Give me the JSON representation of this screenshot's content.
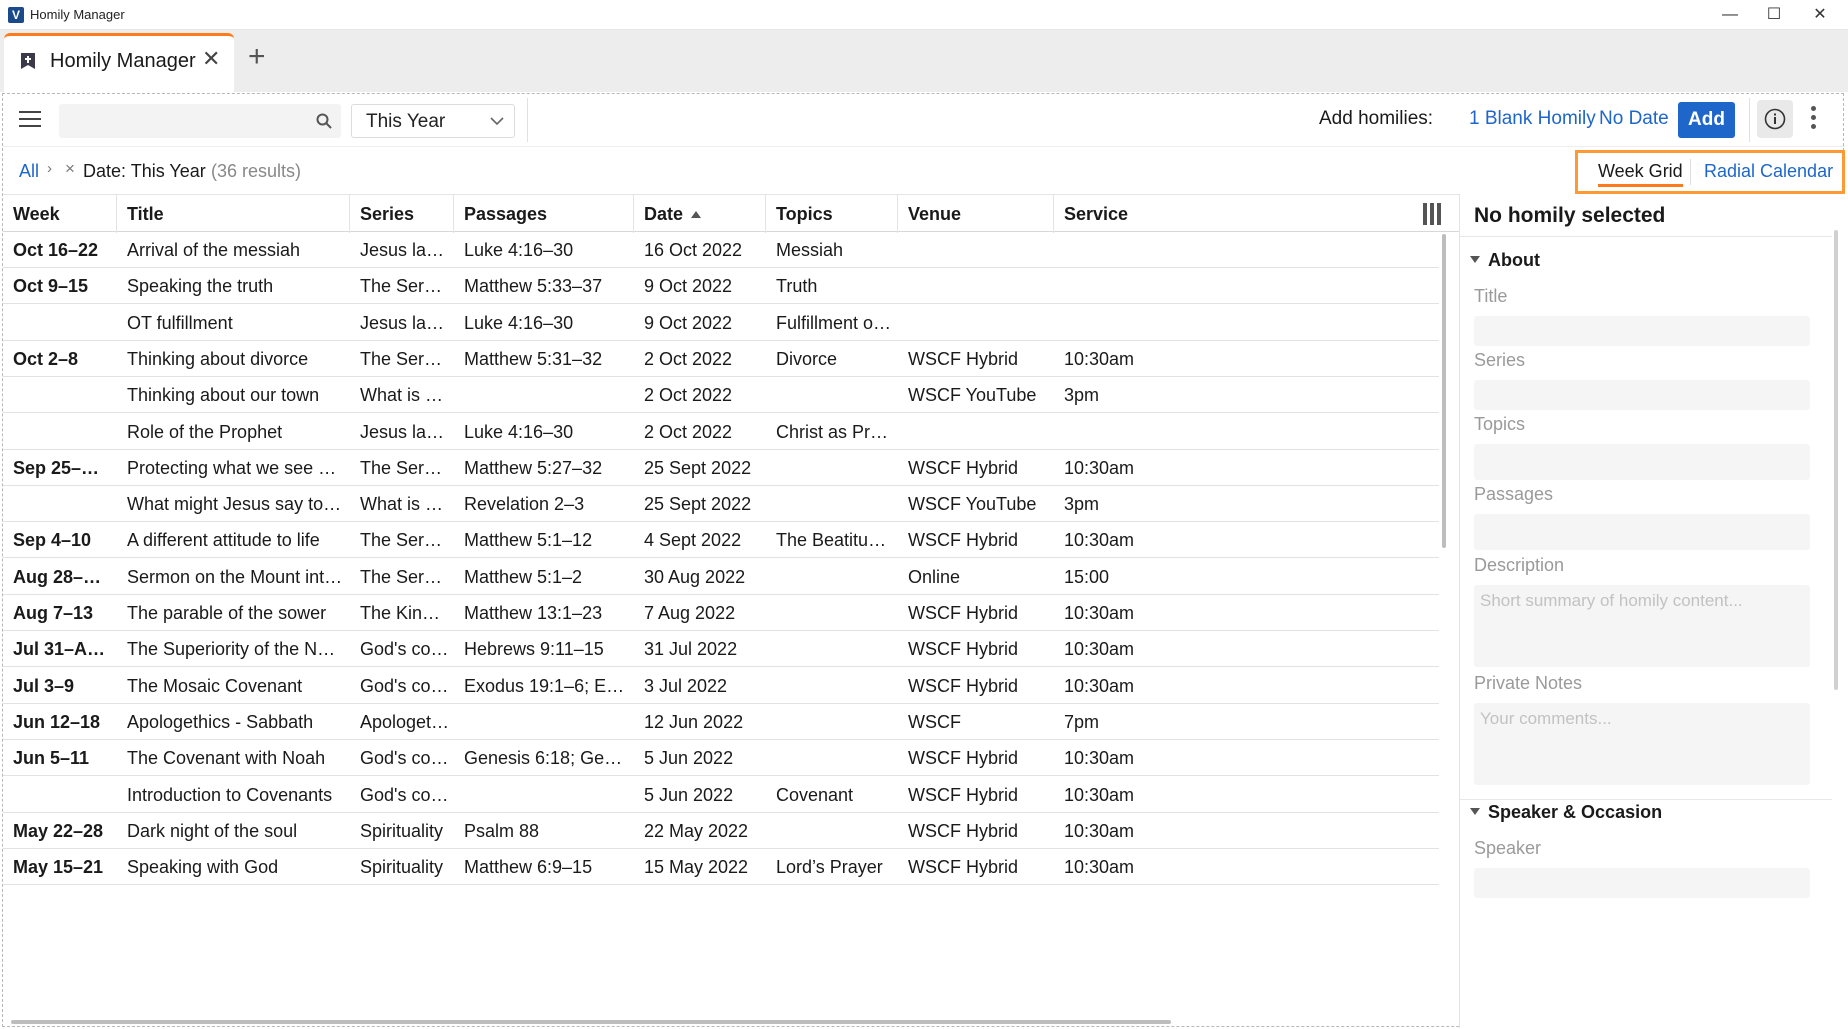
{
  "window": {
    "title": "Homily Manager",
    "icon": "V",
    "minimize": "—",
    "maximize": "☐",
    "close": "✕"
  },
  "tab": {
    "label": "Homily Manager",
    "close": "✕",
    "add": "+"
  },
  "toolbar": {
    "search_value": "",
    "date_filter": "This Year",
    "add_label": "Add homilies:",
    "add_blank": "1 Blank Homily",
    "add_nodate": "No Date",
    "add_button": "Add"
  },
  "filter": {
    "all": "All",
    "sep": "›",
    "remove": "×",
    "text": "Date: This Year",
    "count": "(36 results)"
  },
  "views": {
    "week_grid": "Week Grid",
    "radial_calendar": "Radial Calendar",
    "active": "Week Grid"
  },
  "columns": [
    "Week",
    "Title",
    "Series",
    "Passages",
    "Date",
    "Topics",
    "Venue",
    "Service"
  ],
  "rows": [
    {
      "week": "Oct 16–22",
      "title": "Arrival of the messiah",
      "series": "Jesus la…",
      "passages": "Luke 4:16–30",
      "date": "16 Oct 2022",
      "topics": "Messiah",
      "venue": "",
      "service": ""
    },
    {
      "week": "Oct 9–15",
      "title": "Speaking the truth",
      "series": "The Ser…",
      "passages": "Matthew 5:33–37",
      "date": "9 Oct 2022",
      "topics": "Truth",
      "venue": "",
      "service": ""
    },
    {
      "week": "",
      "title": "OT fulfillment",
      "series": "Jesus la…",
      "passages": "Luke 4:16–30",
      "date": "9 Oct 2022",
      "topics": "Fulfillment o…",
      "venue": "",
      "service": ""
    },
    {
      "week": "Oct 2–8",
      "title": "Thinking about divorce",
      "series": "The Ser…",
      "passages": "Matthew 5:31–32",
      "date": "2 Oct 2022",
      "topics": "Divorce",
      "venue": "WSCF Hybrid",
      "service": "10:30am"
    },
    {
      "week": "",
      "title": "Thinking about our town",
      "series": "What is G…",
      "passages": "",
      "date": "2 Oct 2022",
      "topics": "",
      "venue": "WSCF YouTube",
      "service": "3pm"
    },
    {
      "week": "",
      "title": "Role of the Prophet",
      "series": "Jesus la…",
      "passages": "Luke 4:16–30",
      "date": "2 Oct 2022",
      "topics": "Christ as Pro…",
      "venue": "",
      "service": ""
    },
    {
      "week": "Sep 25–O…",
      "title": "Protecting what we see an…",
      "series": "The Ser…",
      "passages": "Matthew 5:27–32",
      "date": "25 Sept 2022",
      "topics": "",
      "venue": "WSCF Hybrid",
      "service": "10:30am"
    },
    {
      "week": "",
      "title": "What might Jesus say to us?",
      "series": "What is G…",
      "passages": "Revelation 2–3",
      "date": "25 Sept 2022",
      "topics": "",
      "venue": "WSCF YouTube",
      "service": "3pm"
    },
    {
      "week": "Sep 4–10",
      "title": "A different attitude to life",
      "series": "The Ser…",
      "passages": "Matthew 5:1–12",
      "date": "4 Sept 2022",
      "topics": "The Beatitudes",
      "venue": "WSCF Hybrid",
      "service": "10:30am"
    },
    {
      "week": "Aug 28–Se…",
      "title": "Sermon on the Mount intr…",
      "series": "The Ser…",
      "passages": "Matthew 5:1–2",
      "date": "30 Aug 2022",
      "topics": "",
      "venue": "Online",
      "service": "15:00"
    },
    {
      "week": "Aug 7–13",
      "title": "The parable of the sower",
      "series": "The King…",
      "passages": "Matthew 13:1–23",
      "date": "7 Aug 2022",
      "topics": "",
      "venue": "WSCF Hybrid",
      "service": "10:30am"
    },
    {
      "week": "Jul 31–Aug 6",
      "title": "The Superiority of the Ne…",
      "series": "God's co…",
      "passages": "Hebrews 9:11–15",
      "date": "31 Jul 2022",
      "topics": "",
      "venue": "WSCF Hybrid",
      "service": "10:30am"
    },
    {
      "week": "Jul 3–9",
      "title": "The Mosaic Covenant",
      "series": "God's co…",
      "passages": "Exodus 19:1–6; Exo…",
      "date": "3 Jul 2022",
      "topics": "",
      "venue": "WSCF Hybrid",
      "service": "10:30am"
    },
    {
      "week": "Jun 12–18",
      "title": "Apologethics - Sabbath",
      "series": "Apologet…",
      "passages": "",
      "date": "12 Jun 2022",
      "topics": "",
      "venue": "WSCF",
      "service": "7pm"
    },
    {
      "week": "Jun 5–11",
      "title": "The Covenant with Noah",
      "series": "God's co…",
      "passages": "Genesis 6:18; Gene…",
      "date": "5 Jun 2022",
      "topics": "",
      "venue": "WSCF Hybrid",
      "service": "10:30am"
    },
    {
      "week": "",
      "title": "Introduction to Covenants",
      "series": "God's co…",
      "passages": "",
      "date": "5 Jun 2022",
      "topics": "Covenant",
      "venue": "WSCF Hybrid",
      "service": "10:30am"
    },
    {
      "week": "May 22–28",
      "title": "Dark night of the soul",
      "series": "Spirituality",
      "passages": "Psalm 88",
      "date": "22 May 2022",
      "topics": "",
      "venue": "WSCF Hybrid",
      "service": "10:30am"
    },
    {
      "week": "May 15–21",
      "title": "Speaking with God",
      "series": "Spirituality",
      "passages": "Matthew 6:9–15",
      "date": "15 May 2022",
      "topics": "Lord’s Prayer",
      "venue": "WSCF Hybrid",
      "service": "10:30am"
    }
  ],
  "details": {
    "heading": "No homily selected",
    "about_section": "About",
    "title_label": "Title",
    "series_label": "Series",
    "topics_label": "Topics",
    "passages_label": "Passages",
    "description_label": "Description",
    "description_placeholder": "Short summary of homily content...",
    "notes_label": "Private Notes",
    "notes_placeholder": "Your comments...",
    "speaker_section": "Speaker & Occasion",
    "speaker_label": "Speaker"
  },
  "colors": {
    "accent_orange": "#ff7a1a",
    "link_blue": "#1e66c9"
  }
}
